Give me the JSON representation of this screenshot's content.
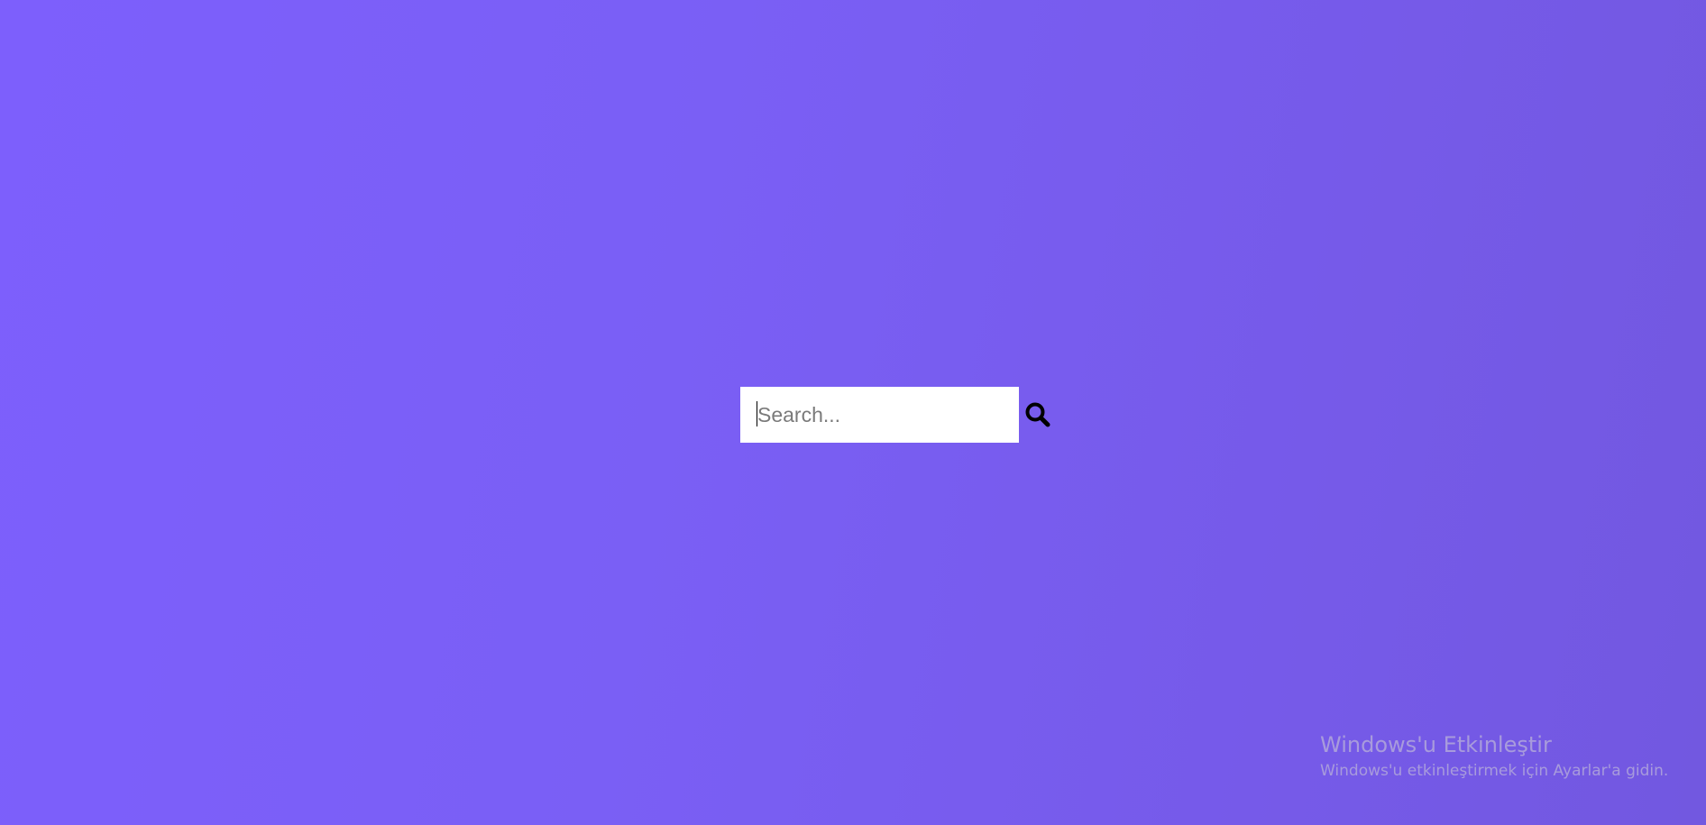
{
  "search": {
    "placeholder": "Search...",
    "value": "",
    "button_icon": "search-icon"
  },
  "watermark": {
    "title": "Windows'u Etkinleştir",
    "subtitle": "Windows'u etkinleştirmek için Ayarlar'a gidin."
  },
  "colors": {
    "background_start": "#7d5ffc",
    "background_end": "#7258e0",
    "search_box": "#ffffff",
    "icon": "#000000",
    "watermark_text": "#a89bdc"
  }
}
